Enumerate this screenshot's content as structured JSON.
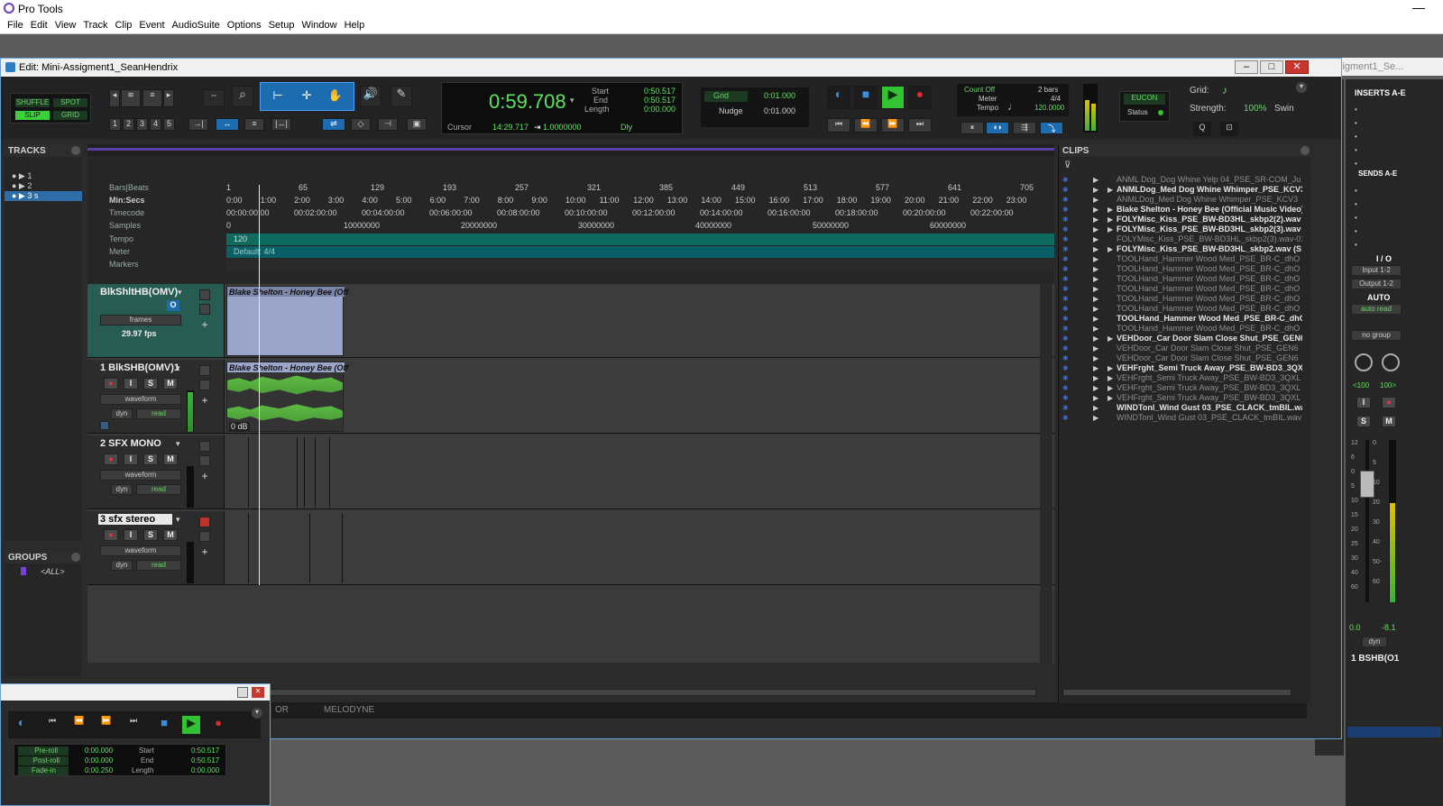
{
  "app": {
    "title": "Pro Tools",
    "min": "—"
  },
  "menu": [
    "File",
    "Edit",
    "View",
    "Track",
    "Clip",
    "Event",
    "AudioSuite",
    "Options",
    "Setup",
    "Window",
    "Help"
  ],
  "edit_window": {
    "title": "Edit: Mini-Assigment1_SeanHendrix",
    "bg_title": "i-Assigment1_Se..."
  },
  "toolbar": {
    "modes": [
      "SHUFFLE",
      "SPOT",
      "SLIP",
      "GRID"
    ],
    "zoom_presets": [
      "1",
      "2",
      "3",
      "4",
      "5"
    ],
    "main_counter": "0:59.708",
    "start_label": "Start",
    "end_label": "End",
    "length_label": "Length",
    "start": "0:50.517",
    "end": "0:50.517",
    "length": "0:00.000",
    "cursor_label": "Cursor",
    "cursor": "14:29.717",
    "nudge_value": "1.0000000",
    "dly": "Dly",
    "grid_label": "Grid",
    "grid_value": "0:01.000",
    "nudge_label": "Nudge",
    "nudge_val": "0:01.000",
    "count_off": "Count Off",
    "count_bars": "2 bars",
    "meter_label": "Meter",
    "meter": "4/4",
    "tempo_label": "Tempo",
    "tempo": "120.0000",
    "eucon": "EUCON",
    "status": "Status",
    "grid2": "Grid:",
    "strength": "Strength:",
    "strength_val": "100%",
    "swing": "Swin"
  },
  "tracks_pane": {
    "title": "TRACKS",
    "items": [
      "1",
      "2",
      "3 s"
    ]
  },
  "groups_pane": {
    "title": "GROUPS",
    "all": "<ALL>"
  },
  "rulers": {
    "labels": [
      "Bars|Beats",
      "Min:Secs",
      "Timecode",
      "Samples",
      "Tempo",
      "Meter",
      "Markers"
    ],
    "bars": [
      "1",
      "65",
      "129",
      "193",
      "257",
      "321",
      "385",
      "449",
      "513",
      "577",
      "641",
      "705"
    ],
    "mins": [
      "0:00",
      "1:00",
      "2:00",
      "3:00",
      "4:00",
      "5:00",
      "6:00",
      "7:00",
      "8:00",
      "9:00",
      "10:00",
      "11:00",
      "12:00",
      "13:00",
      "14:00",
      "15:00",
      "16:00",
      "17:00",
      "18:00",
      "19:00",
      "20:00",
      "21:00",
      "22:00",
      "23:00"
    ],
    "timecode": [
      "00:00:00:00",
      "00:02:00:00",
      "00:04:00:00",
      "00:06:00:00",
      "00:08:00:00",
      "00:10:00:00",
      "00:12:00:00",
      "00:14:00:00",
      "00:16:00:00",
      "00:18:00:00",
      "00:20:00:00",
      "00:22:00:00"
    ],
    "samples": [
      "0",
      "10000000",
      "20000000",
      "30000000",
      "40000000",
      "50000000",
      "60000000"
    ],
    "tempo_val": "120",
    "meter_val": "Default: 4/4"
  },
  "tracks": [
    {
      "name": "BlkShltHB(OMV)",
      "sel1": "frames",
      "fps": "29.97 fps",
      "clip": "Blake Shelton - Honey Bee (Off"
    },
    {
      "name": "1 BlkSHB(OMV)1",
      "sel1": "waveform",
      "dyn": "dyn",
      "auto": "read",
      "clip": "Blake Shelton - Honey Bee (Off",
      "gain": "0 dB"
    },
    {
      "name": "2   SFX MONO",
      "sel1": "waveform",
      "dyn": "dyn",
      "auto": "read"
    },
    {
      "name": "3   sfx stereo",
      "sel1": "waveform",
      "dyn": "dyn",
      "auto": "read"
    }
  ],
  "track_buttons": {
    "rec": "●",
    "input": "I",
    "solo": "S",
    "mute": "M",
    "o": "O"
  },
  "clips_pane": {
    "title": "CLIPS",
    "items": [
      {
        "name": "ANML Dog_Dog Whine Yelp 04_PSE_SR-COM_Ju",
        "bold": false,
        "tri": false
      },
      {
        "name": "ANMLDog_Med Dog Whine Whimper_PSE_KCV3",
        "bold": true,
        "tri": true
      },
      {
        "name": "ANMLDog_Med Dog Whine Whimper_PSE_KCV3",
        "bold": false,
        "tri": false
      },
      {
        "name": "Blake Shelton - Honey Bee (Official Music Video)",
        "bold": true,
        "tri": true
      },
      {
        "name": "FOLYMisc_Kiss_PSE_BW-BD3HL_skbp2(2).wav",
        "bold": true,
        "tri": true
      },
      {
        "name": "FOLYMisc_Kiss_PSE_BW-BD3HL_skbp2(3).wav",
        "bold": true,
        "tri": true
      },
      {
        "name": "FOLYMisc_Kiss_PSE_BW-BD3HL_skbp2(3).wav-01",
        "bold": false,
        "tri": false
      },
      {
        "name": "FOLYMisc_Kiss_PSE_BW-BD3HL_skbp2.wav (S",
        "bold": true,
        "tri": true
      },
      {
        "name": "TOOLHand_Hammer Wood Med_PSE_BR-C_dhO",
        "bold": false,
        "tri": false
      },
      {
        "name": "TOOLHand_Hammer Wood Med_PSE_BR-C_dhO",
        "bold": false,
        "tri": false
      },
      {
        "name": "TOOLHand_Hammer Wood Med_PSE_BR-C_dhO",
        "bold": false,
        "tri": false
      },
      {
        "name": "TOOLHand_Hammer Wood Med_PSE_BR-C_dhO",
        "bold": false,
        "tri": false
      },
      {
        "name": "TOOLHand_Hammer Wood Med_PSE_BR-C_dhO",
        "bold": false,
        "tri": false
      },
      {
        "name": "TOOLHand_Hammer Wood Med_PSE_BR-C_dhO",
        "bold": false,
        "tri": false
      },
      {
        "name": "TOOLHand_Hammer Wood Med_PSE_BR-C_dhO",
        "bold": true,
        "tri": false
      },
      {
        "name": "TOOLHand_Hammer Wood Med_PSE_BR-C_dhO",
        "bold": false,
        "tri": false
      },
      {
        "name": "VEHDoor_Car Door Slam Close Shut_PSE_GEN6",
        "bold": true,
        "tri": true
      },
      {
        "name": "VEHDoor_Car Door Slam Close Shut_PSE_GEN6",
        "bold": false,
        "tri": false
      },
      {
        "name": "VEHDoor_Car Door Slam Close Shut_PSE_GEN6",
        "bold": false,
        "tri": false
      },
      {
        "name": "VEHFrght_Semi Truck Away_PSE_BW-BD3_3QX",
        "bold": true,
        "tri": true
      },
      {
        "name": "VEHFrght_Semi Truck Away_PSE_BW-BD3_3QXL",
        "bold": false,
        "tri": true
      },
      {
        "name": "VEHFrght_Semi Truck Away_PSE_BW-BD3_3QXL",
        "bold": false,
        "tri": true
      },
      {
        "name": "VEHFrght_Semi Truck Away_PSE_BW-BD3_3QXL",
        "bold": false,
        "tri": true
      },
      {
        "name": "WINDTonl_Wind Gust 03_PSE_CLACK_tmBIL.wa",
        "bold": true,
        "tri": false
      },
      {
        "name": "WINDTonl_Wind Gust 03_PSE_CLACK_tmBIL.wav",
        "bold": false,
        "tri": false
      }
    ]
  },
  "bottom_tabs": [
    "OR",
    "MELODYNE"
  ],
  "mixer": {
    "inserts": "INSERTS A-E",
    "sends": "SENDS A-E",
    "io": "I / O",
    "input": "Input 1-2",
    "output": "Output 1-2",
    "auto": "AUTO",
    "auto_mode": "auto read",
    "group": "no group",
    "pan_l": "<100",
    "pan_r": "100>",
    "vol": "0.0",
    "peak": "-8.1",
    "dyn": "dyn",
    "track": "1 BSHB(O1",
    "scale_l": [
      "12",
      "6",
      "0",
      "5",
      "10",
      "15",
      "20",
      "25",
      "30",
      "40",
      "60"
    ],
    "scale_r": [
      "0",
      "5",
      "10",
      "20",
      "30",
      "40",
      "50-",
      "60"
    ],
    "solo": "S",
    "mute": "M",
    "input_btn": "I"
  },
  "transport": {
    "preroll_label": "Pre-roll",
    "postroll_label": "Post-roll",
    "fadein_label": "Fade-in",
    "preroll": "0:00.000",
    "postroll": "0:00.000",
    "fadein": "0:00.250",
    "start": "0:50.517",
    "end": "0:50.517",
    "length": "0:00.000",
    "start_label": "Start",
    "end_label": "End",
    "length_label": "Length"
  },
  "colors": {
    "accent": "#2d7fc1",
    "clip_blue": "#9ba5c9",
    "wave_green": "#5fbf45",
    "tempo_teal": "#0e6b5e",
    "meter_teal": "#0b5f66",
    "play_green": "#33c233",
    "rec_red": "#d92b2b"
  }
}
